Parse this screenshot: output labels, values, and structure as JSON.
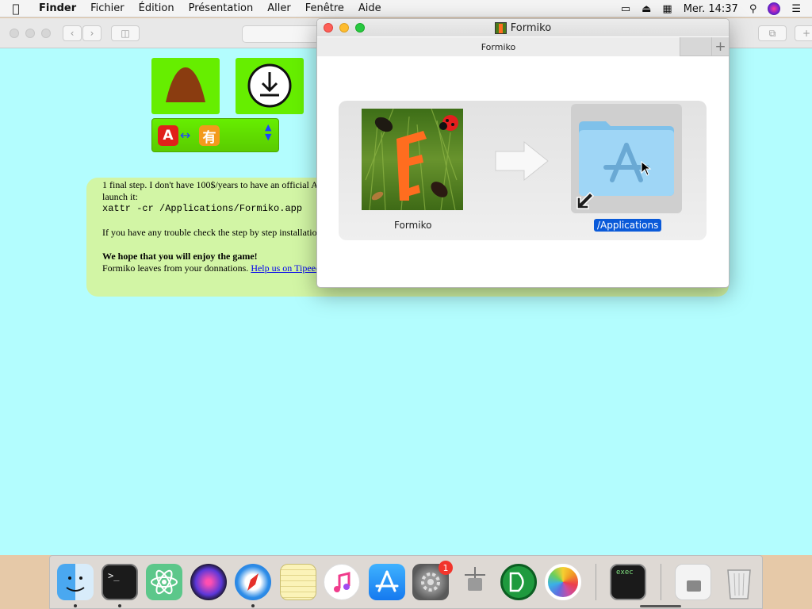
{
  "menubar": {
    "app": "Finder",
    "items": [
      "Fichier",
      "Édition",
      "Présentation",
      "Aller",
      "Fenêtre",
      "Aide"
    ],
    "clock": "Mer. 14:37"
  },
  "page": {
    "info_lines": [
      "1 final step. I don't have 100$/years to have an official A",
      "launch it:",
      "xattr -cr /Applications/Formiko.app",
      "If you have any trouble check the step by step installatio",
      "We hope that you will enjoy the game!",
      "Formiko leaves from your donnations."
    ],
    "help_link": "Help us on Tipeee"
  },
  "dmg": {
    "title": "Formiko",
    "tab": "Formiko",
    "app_caption": "Formiko",
    "apps_caption": "/Applications"
  },
  "dock": {
    "badge_count": "1",
    "exec_label": "exec"
  }
}
